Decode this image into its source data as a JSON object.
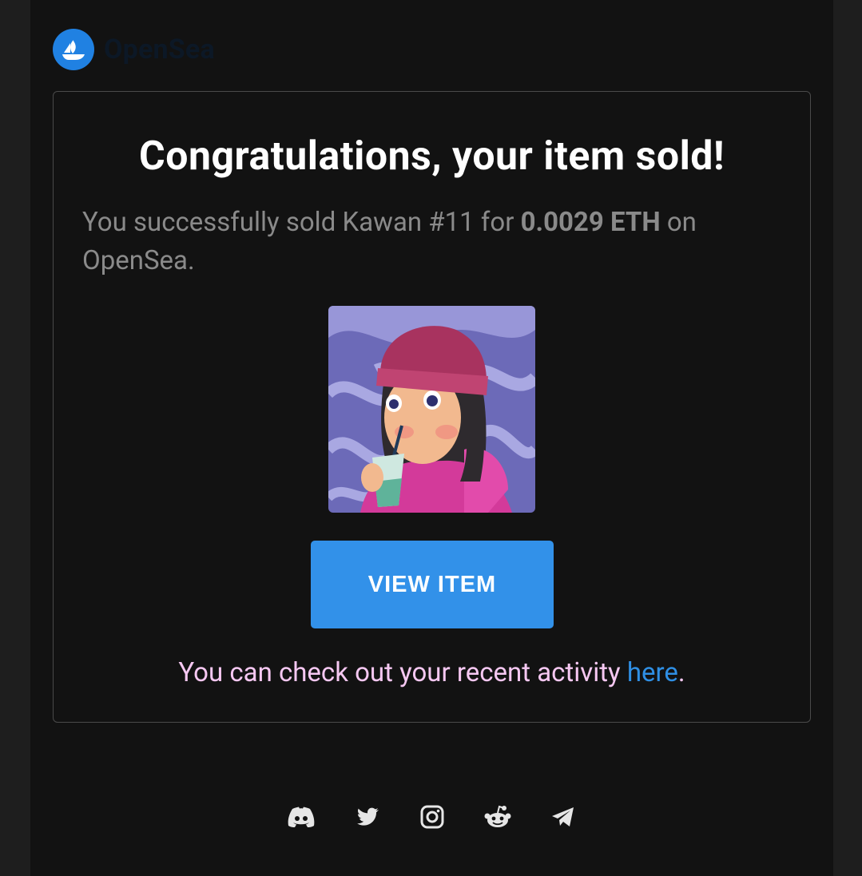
{
  "brand": {
    "name": "OpenSea",
    "logo_color": "#2081e2"
  },
  "card": {
    "heading": "Congratulations, your item sold!",
    "message_prefix": "You successfully sold Kawan #11 for ",
    "price": "0.0029 ETH",
    "message_suffix": " on OpenSea.",
    "view_button": "VIEW ITEM",
    "activity_prefix": "You can check out your recent activity ",
    "activity_link": "here",
    "activity_suffix": "."
  },
  "social_icons": [
    "discord-icon",
    "twitter-icon",
    "instagram-icon",
    "reddit-icon",
    "telegram-icon"
  ],
  "colors": {
    "accent": "#3291e9",
    "activity_text": "#f6c8f2",
    "link": "#2f8fe4"
  }
}
